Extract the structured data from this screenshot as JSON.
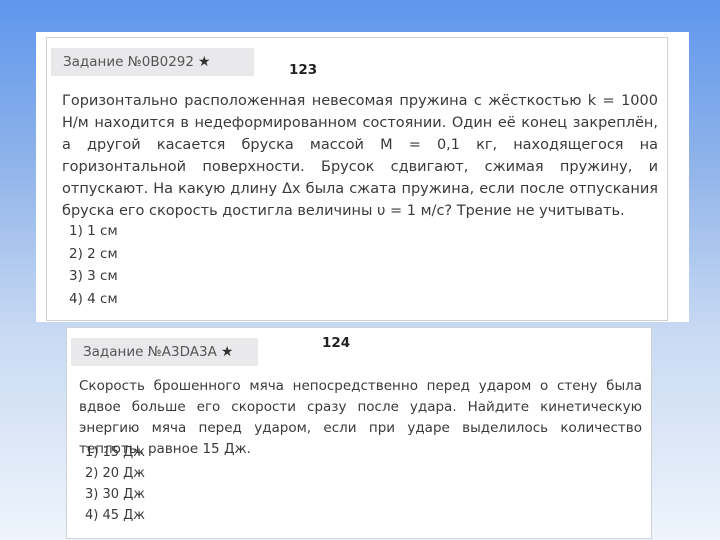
{
  "tasks": [
    {
      "header": "Задание №0B0292",
      "number": "123",
      "question": "Горизонтально расположенная невесомая пружина с жёсткостью k = 1000 Н/м находится в недеформированном состоянии. Один её конец закреплён, а другой касается бруска массой M = 0,1 кг, находящегося на горизонтальной поверхности. Брусок сдвигают, сжимая пружину, и отпускают. На какую длину Δx была сжата пружина, если после отпускания бруска его скорость достигла величины υ = 1 м/с? Трение не учитывать.",
      "options": [
        "1) 1 см",
        "2) 2 см",
        "3) 3 см",
        "4) 4 см"
      ]
    },
    {
      "header": "Задание №A3DA3A",
      "number": "124",
      "question": "Скорость брошенного мяча непосредственно перед ударом о стену была вдвое больше его скорости сразу после удара. Найдите кинетическую энергию мяча перед ударом, если при ударе выделилось количество теплоты, равное 15 Дж.",
      "options": [
        "1) 15 Дж",
        "2) 20 Дж",
        "3) 30 Дж",
        "4) 45 Дж"
      ]
    }
  ],
  "star_icon": "star-icon"
}
